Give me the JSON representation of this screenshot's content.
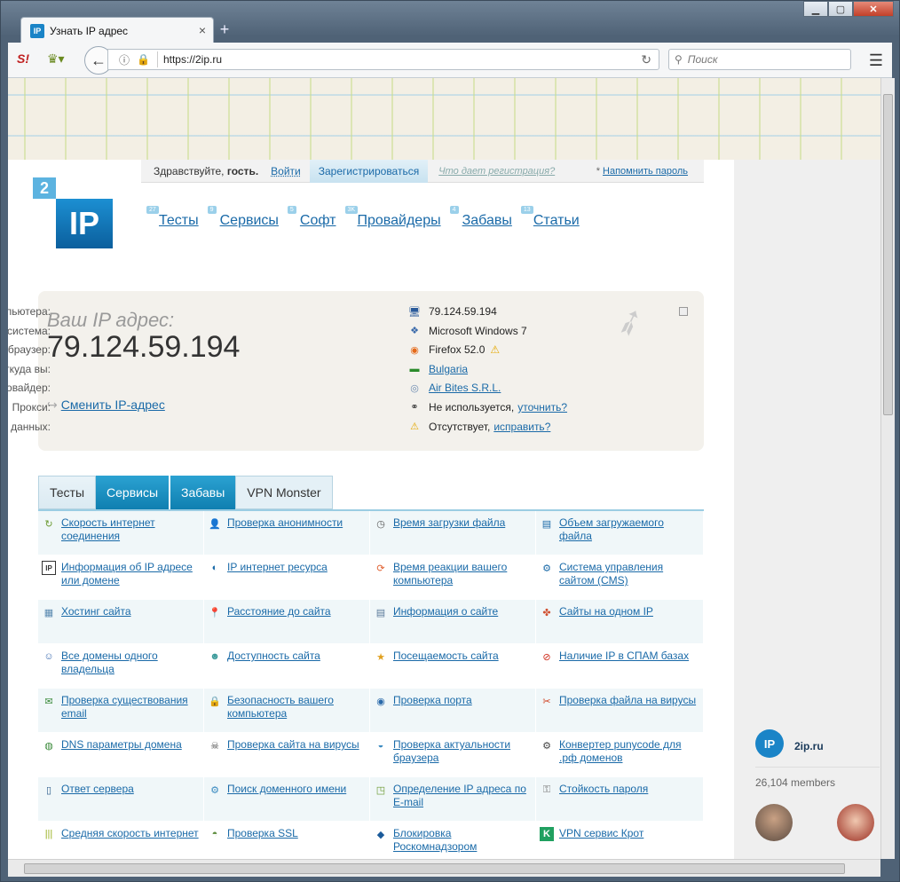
{
  "window": {
    "tab_title": "Узнать IP адрес",
    "new_tab": "+",
    "close_tab": "×"
  },
  "nav": {
    "url": "https://2ip.ru",
    "search_placeholder": "Поиск"
  },
  "topbar": {
    "greeting_prefix": "Здравствуйте,",
    "greeting_user": "гость.",
    "login": "Войти",
    "register": "Зарегистрироваться",
    "what": "Что дает регистрация?",
    "remind": "Напомнить пароль",
    "remind_star": "*"
  },
  "logo": {
    "badge": "2",
    "main": "IP"
  },
  "mainnav": [
    {
      "count": "27",
      "label": "Тесты"
    },
    {
      "count": "9",
      "label": "Сервисы"
    },
    {
      "count": "5",
      "label": "Софт"
    },
    {
      "count": "3K",
      "label": "Провайдеры"
    },
    {
      "count": "4",
      "label": "Забавы"
    },
    {
      "count": "13",
      "label": "Статьи"
    }
  ],
  "ipbox": {
    "label": "Ваш IP адрес:",
    "ip": "79.124.59.194",
    "change": "Сменить IP-адрес",
    "rows": [
      {
        "key": "Имя вашего компьютера:",
        "value": "79.124.59.194",
        "icon": "computer-icon"
      },
      {
        "key": "Операционная система:",
        "value": "Microsoft Windows 7",
        "icon": "windows-icon"
      },
      {
        "key": "Ваш браузер:",
        "value": "Firefox 52.0",
        "icon": "firefox-icon"
      },
      {
        "key": "Откуда вы:",
        "value": "Bulgaria",
        "icon": "flag-icon"
      },
      {
        "key": "Ваш провайдер:",
        "value": "Air Bites S.R.L.",
        "icon": "provider-icon"
      },
      {
        "key": "Прокси:",
        "value": "Не используется,",
        "extra": "уточнить?",
        "icon": "glasses-icon"
      },
      {
        "key": "Защита данных:",
        "value": "Отсутствует,",
        "extra": "исправить?",
        "icon": "warning-icon"
      }
    ]
  },
  "tabs": [
    "Тесты",
    "Сервисы",
    "Забавы",
    "VPN Monster"
  ],
  "services": [
    [
      "Скорость интернет соединения",
      "Проверка анонимности",
      "Время загрузки файла",
      "Объем загружаемого файла"
    ],
    [
      "Информация об IP адресе или домене",
      "IP интернет ресурса",
      "Время реакции вашего компьютера",
      "Система управления сайтом (CMS)"
    ],
    [
      "Хостинг сайта",
      "Расстояние до сайта",
      "Информация о сайте",
      "Сайты на одном IP"
    ],
    [
      "Все домены одного владельца",
      "Доступность сайта",
      "Посещаемость сайта",
      "Наличие IP в СПАМ базах"
    ],
    [
      "Проверка существования email",
      "Безопасность вашего компьютера",
      "Проверка порта",
      "Проверка файла на вирусы"
    ],
    [
      "DNS параметры домена",
      "Проверка сайта на вирусы",
      "Проверка актуальности браузера",
      "Конвертер punycode для .рф доменов"
    ],
    [
      "Ответ сервера",
      "Поиск доменного имени",
      "Определение IP адреса по E-mail",
      "Стойкость пароля"
    ],
    [
      "Средняя скорость интернет",
      "Проверка SSL",
      "Блокировка Роскомнадзором",
      "VPN сервис Крот"
    ]
  ],
  "widget": {
    "logo": "IP",
    "name": "2ip.ru",
    "members": "26,104 members"
  }
}
